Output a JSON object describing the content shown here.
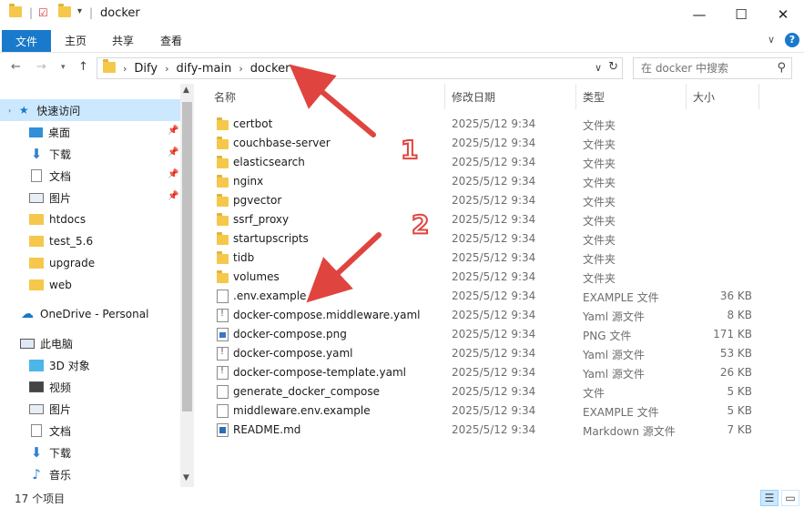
{
  "window": {
    "title": "docker",
    "minimize": "—",
    "maximize": "☐",
    "close": "✕"
  },
  "ribbon": {
    "file_tab": "文件",
    "tabs": [
      "主页",
      "共享",
      "查看"
    ],
    "collapse": "∨",
    "help": "?"
  },
  "address": {
    "crumbs": [
      "Dify",
      "dify-main",
      "docker"
    ],
    "search_placeholder": "在 docker 中搜索"
  },
  "nav": {
    "quick_access": "快速访问",
    "quick_items": [
      {
        "label": "桌面",
        "icon": "desktop-icon",
        "pinned": true
      },
      {
        "label": "下载",
        "icon": "download-icon",
        "pinned": true
      },
      {
        "label": "文档",
        "icon": "document-icon",
        "pinned": true
      },
      {
        "label": "图片",
        "icon": "pictures-icon",
        "pinned": true
      },
      {
        "label": "htdocs",
        "icon": "folder-icon",
        "pinned": false
      },
      {
        "label": "test_5.6",
        "icon": "folder-icon",
        "pinned": false
      },
      {
        "label": "upgrade",
        "icon": "folder-icon",
        "pinned": false
      },
      {
        "label": "web",
        "icon": "folder-icon",
        "pinned": false
      }
    ],
    "onedrive": "OneDrive - Personal",
    "this_pc": "此电脑",
    "pc_items": [
      {
        "label": "3D 对象",
        "icon": "3d-objects-icon"
      },
      {
        "label": "视频",
        "icon": "videos-icon"
      },
      {
        "label": "图片",
        "icon": "pictures-icon"
      },
      {
        "label": "文档",
        "icon": "document-icon"
      },
      {
        "label": "下载",
        "icon": "download-icon"
      },
      {
        "label": "音乐",
        "icon": "music-icon"
      }
    ]
  },
  "columns": {
    "name": "名称",
    "date": "修改日期",
    "type": "类型",
    "size": "大小"
  },
  "files": [
    {
      "name": "certbot",
      "date": "2025/5/12 9:34",
      "type": "文件夹",
      "size": "",
      "icon": "folder"
    },
    {
      "name": "couchbase-server",
      "date": "2025/5/12 9:34",
      "type": "文件夹",
      "size": "",
      "icon": "folder"
    },
    {
      "name": "elasticsearch",
      "date": "2025/5/12 9:34",
      "type": "文件夹",
      "size": "",
      "icon": "folder"
    },
    {
      "name": "nginx",
      "date": "2025/5/12 9:34",
      "type": "文件夹",
      "size": "",
      "icon": "folder"
    },
    {
      "name": "pgvector",
      "date": "2025/5/12 9:34",
      "type": "文件夹",
      "size": "",
      "icon": "folder"
    },
    {
      "name": "ssrf_proxy",
      "date": "2025/5/12 9:34",
      "type": "文件夹",
      "size": "",
      "icon": "folder"
    },
    {
      "name": "startupscripts",
      "date": "2025/5/12 9:34",
      "type": "文件夹",
      "size": "",
      "icon": "folder"
    },
    {
      "name": "tidb",
      "date": "2025/5/12 9:34",
      "type": "文件夹",
      "size": "",
      "icon": "folder"
    },
    {
      "name": "volumes",
      "date": "2025/5/12 9:34",
      "type": "文件夹",
      "size": "",
      "icon": "folder"
    },
    {
      "name": ".env.example",
      "date": "2025/5/12 9:34",
      "type": "EXAMPLE 文件",
      "size": "36 KB",
      "icon": "doc"
    },
    {
      "name": "docker-compose.middleware.yaml",
      "date": "2025/5/12 9:34",
      "type": "Yaml 源文件",
      "size": "8 KB",
      "icon": "yaml"
    },
    {
      "name": "docker-compose.png",
      "date": "2025/5/12 9:34",
      "type": "PNG 文件",
      "size": "171 KB",
      "icon": "png"
    },
    {
      "name": "docker-compose.yaml",
      "date": "2025/5/12 9:34",
      "type": "Yaml 源文件",
      "size": "53 KB",
      "icon": "yaml"
    },
    {
      "name": "docker-compose-template.yaml",
      "date": "2025/5/12 9:34",
      "type": "Yaml 源文件",
      "size": "26 KB",
      "icon": "yaml"
    },
    {
      "name": "generate_docker_compose",
      "date": "2025/5/12 9:34",
      "type": "文件",
      "size": "5 KB",
      "icon": "doc"
    },
    {
      "name": "middleware.env.example",
      "date": "2025/5/12 9:34",
      "type": "EXAMPLE 文件",
      "size": "5 KB",
      "icon": "doc"
    },
    {
      "name": "README.md",
      "date": "2025/5/12 9:34",
      "type": "Markdown 源文件",
      "size": "7 KB",
      "icon": "md"
    }
  ],
  "status": {
    "item_count": "17 个项目"
  },
  "annotations": {
    "label_1": "1",
    "label_2": "2",
    "color": "#e0443e"
  }
}
